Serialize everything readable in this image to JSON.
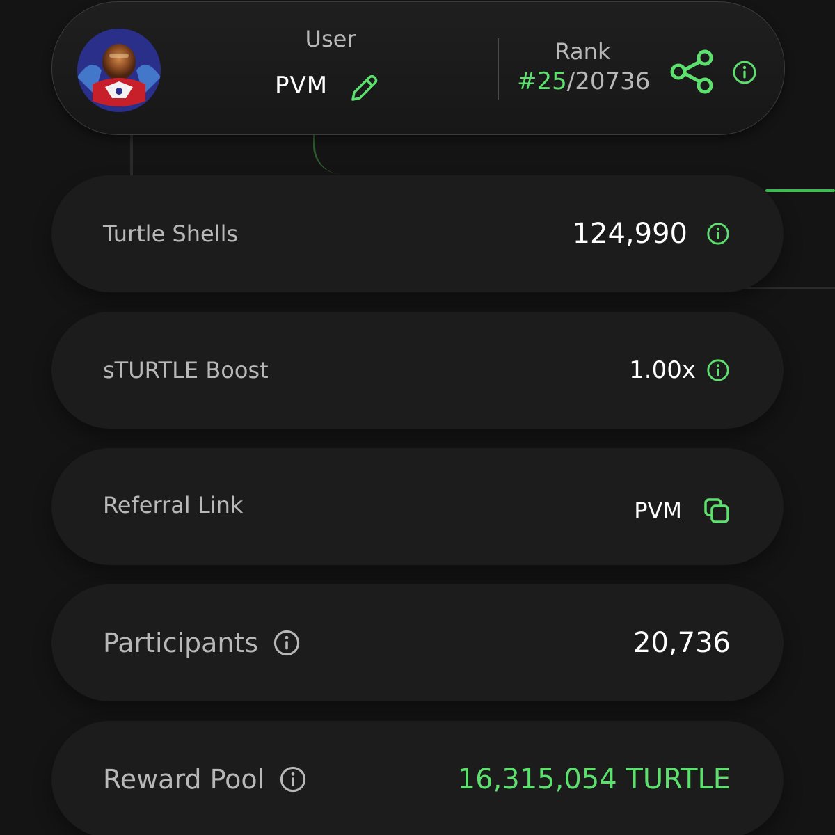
{
  "header": {
    "user_label": "User",
    "user_name": "PVM",
    "rank_label": "Rank",
    "rank_position": "#25",
    "rank_total": "/20736"
  },
  "stats": {
    "turtle_shells": {
      "label": "Turtle Shells",
      "value": "124,990"
    },
    "sturtle_boost": {
      "label": "sTURTLE Boost",
      "value": "1.00x"
    },
    "referral_link": {
      "label": "Referral Link",
      "value": "PVM"
    },
    "participants": {
      "label": "Participants",
      "value": "20,736"
    },
    "reward_pool": {
      "label": "Reward Pool",
      "value": "16,315,054 TURTLE"
    }
  },
  "icons": {
    "edit": "pencil-icon",
    "share": "share-icon",
    "info": "info-icon",
    "copy": "copy-icon"
  },
  "colors": {
    "accent": "#5ee06f",
    "background": "#141414",
    "card": "#1c1c1c",
    "muted_text": "#b8b8b8"
  }
}
